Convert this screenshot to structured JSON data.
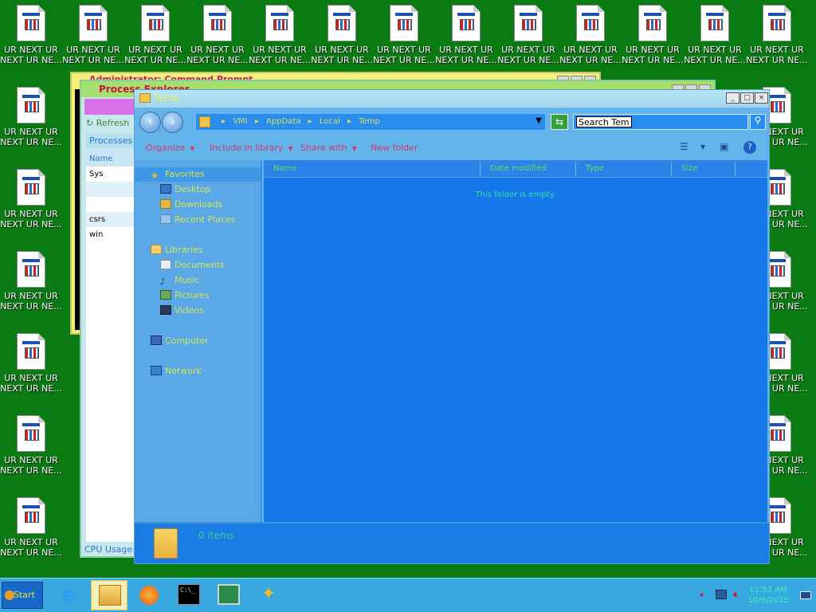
{
  "desktop": {
    "icon_label_line1": "UR NEXT UR",
    "icon_label_line2": "NEXT UR NE..."
  },
  "cmd_window": {
    "title": "Administrator: Command Prompt"
  },
  "task_manager": {
    "title": "Process Explorer",
    "refresh_label": "Refresh",
    "tab_label": "Processes",
    "column_name": "Name",
    "rows": [
      "Sys",
      "",
      "",
      "csrs",
      "win",
      ""
    ],
    "status": "CPU Usage:"
  },
  "explorer": {
    "title": "Temp",
    "breadcrumb": [
      "VMI",
      "AppData",
      "Local",
      "Temp"
    ],
    "search_value": "Search Temp",
    "commands": [
      "Organize",
      "Include in library",
      "Share with",
      "New folder"
    ],
    "nav": {
      "favorites": "Favorites",
      "favorites_items": [
        "Desktop",
        "Downloads",
        "Recent Places"
      ],
      "libraries": "Libraries",
      "libraries_items": [
        "Documents",
        "Music",
        "Pictures",
        "Videos"
      ],
      "computer": "Computer",
      "network": "Network"
    },
    "columns": [
      "Name",
      "Date modified",
      "Type",
      "Size"
    ],
    "empty_message": "This folder is empty.",
    "item_count": "0 items"
  },
  "taskbar": {
    "start_label": "Start",
    "pinned": [
      "internet-explorer",
      "windows-explorer",
      "media-player",
      "command-prompt",
      "system-monitor",
      "wizard"
    ],
    "clock_time": "11:53 AM",
    "clock_date": "10/9/2025"
  },
  "colors": {
    "desktop_bg": "#0a7a12",
    "explorer_bg": "#1478e8",
    "accent_text": "#d0e850",
    "command_text": "#d23a6e"
  }
}
